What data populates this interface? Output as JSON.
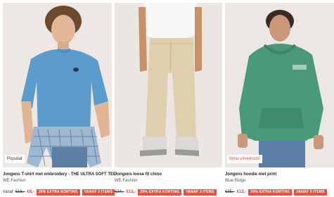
{
  "products": [
    {
      "badge": "Populair",
      "title": "Jongens T-shirt met embroidery - THE ULTRA SOFT TEE",
      "brand": "WE Fashion",
      "from_label": "vanaf",
      "old_price": "€16,-",
      "new_price": "€6,-",
      "promo_tags": [
        "20% EXTRA KORTING",
        "VANAF 3 ITEMS"
      ],
      "image": "boy-blue-tshirt-photo"
    },
    {
      "badge": "",
      "title": "Jongens loose fit chino",
      "brand": "WE Fashion",
      "from_label": "",
      "old_price": "€34,-",
      "new_price": "€12,-",
      "promo_tags": [
        "20% EXTRA KORTING",
        "VANAF 3 ITEMS"
      ],
      "image": "boy-beige-chino-photo"
    },
    {
      "badge": "Bijna uitverkocht",
      "title": "Jongens hoodie met print",
      "brand": "Blue Ridge",
      "from_label": "",
      "old_price": "€35,-",
      "new_price": "€12,-",
      "promo_tags": [
        "20% EXTRA KORTING",
        "VANAF 3 ITEMS"
      ],
      "image": "boy-green-hoodie-photo"
    }
  ],
  "colors": {
    "sale_red": "#e0423b",
    "promo_tag_bg": "#e8533f",
    "badge_low_stock": "#d9534f"
  }
}
